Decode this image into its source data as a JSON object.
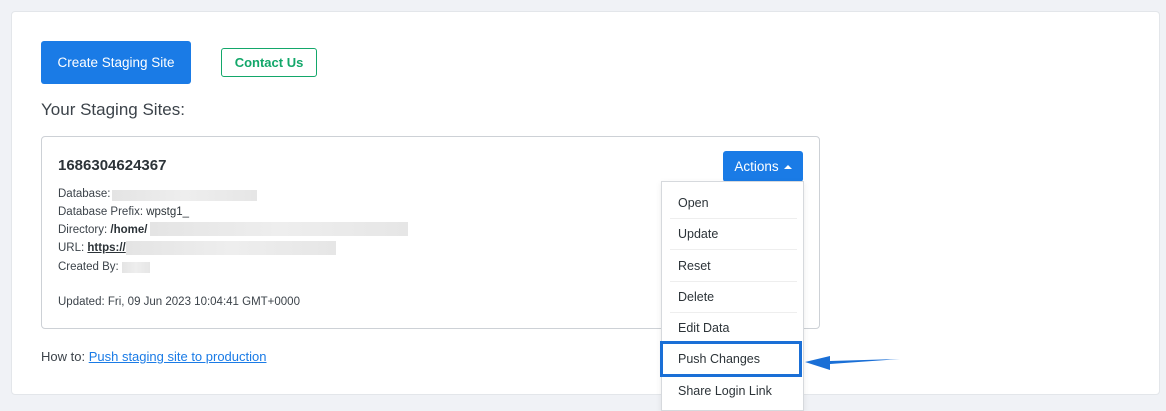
{
  "buttons": {
    "create_staging": "Create Staging Site",
    "contact_us": "Contact Us"
  },
  "section_title": "Your Staging Sites:",
  "site": {
    "name": "1686304624367",
    "database_label": "Database:",
    "database_prefix_label": "Database Prefix:",
    "database_prefix_value": "wpstg1_",
    "directory_label": "Directory:",
    "directory_value": "/home/",
    "url_label": "URL:",
    "url_value": "https://",
    "created_by_label": "Created By:",
    "updated": "Updated: Fri, 09 Jun 2023 10:04:41 GMT+0000"
  },
  "actions": {
    "label": "Actions",
    "items": [
      "Open",
      "Update",
      "Reset",
      "Delete",
      "Edit Data",
      "Push Changes",
      "Share Login Link"
    ]
  },
  "howto": {
    "prefix": "How to:",
    "link": "Push staging site to production"
  },
  "colors": {
    "primary": "#1a7be6",
    "secondary": "#13a76a",
    "highlight": "#1a6fd6"
  },
  "icons": {
    "actions_caret": "caret-up-icon",
    "annotation": "arrow-left-icon"
  }
}
